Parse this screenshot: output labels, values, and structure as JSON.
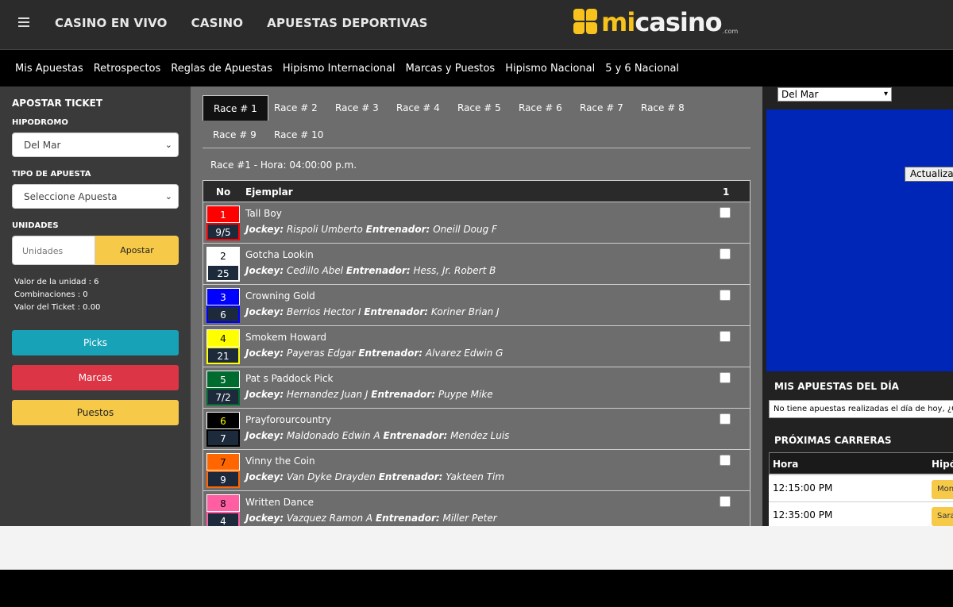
{
  "header": {
    "nav": [
      "CASINO EN VIVO",
      "CASINO",
      "APUESTAS DEPORTIVAS"
    ],
    "logo": {
      "mi": "mi",
      "casino": "casino",
      "com": ".com"
    },
    "colors": {
      "brand_yellow": "#f7c21b",
      "topbar": "#2b2b2b"
    }
  },
  "subnav": [
    "Mis Apuestas",
    "Retrospectos",
    "Reglas de Apuestas",
    "Hipismo Internacional",
    "Marcas y Puestos",
    "Hipismo Nacional",
    "5 y 6 Nacional"
  ],
  "ticket": {
    "title": "APOSTAR TICKET",
    "hipodromo_label": "HIPODROMO",
    "hipodromo_value": "Del Mar",
    "tipo_label": "TIPO DE APUESTA",
    "tipo_value": "Seleccione Apuesta",
    "unidades_label": "UNIDADES",
    "unidades_placeholder": "Unidades",
    "apostar": "Apostar",
    "valor_unidad": "Valor de la unidad : 6",
    "combinaciones": "Combinaciones : 0",
    "valor_ticket": "Valor del Ticket : 0.00",
    "picks": "Picks",
    "marcas": "Marcas",
    "puestos": "Puestos"
  },
  "races": {
    "tabs": [
      "Race # 1",
      "Race # 2",
      "Race # 3",
      "Race # 4",
      "Race # 5",
      "Race # 6",
      "Race # 7",
      "Race # 8",
      "Race # 9",
      "Race # 10"
    ],
    "active_tab": "Race # 1",
    "header": "Race #1 - Hora: 04:00:00 p.m.",
    "columns": {
      "no": "No",
      "ejemplar": "Ejemplar",
      "one": "1"
    },
    "jockey_label": "Jockey:",
    "trainer_label": "Entrenador:",
    "entries": [
      {
        "no": "1",
        "odds": "9/5",
        "horse": "Tall Boy",
        "jockey": "Rispoli Umberto",
        "trainer": "Oneill Doug F",
        "bg": "#ff0000",
        "fg": "#ffffff",
        "border": "#ff0000"
      },
      {
        "no": "2",
        "odds": "25",
        "horse": "Gotcha Lookin",
        "jockey": "Cedillo Abel",
        "trainer": "Hess, Jr. Robert B",
        "bg": "#ffffff",
        "fg": "#000000",
        "border": "#ffffff"
      },
      {
        "no": "3",
        "odds": "6",
        "horse": "Crowning Gold",
        "jockey": "Berrios Hector I",
        "trainer": "Koriner Brian J",
        "bg": "#0000ff",
        "fg": "#ffffff",
        "border": "#0000ff"
      },
      {
        "no": "4",
        "odds": "21",
        "horse": "Smokem Howard",
        "jockey": "Payeras Edgar",
        "trainer": "Alvarez Edwin G",
        "bg": "#ffff00",
        "fg": "#000000",
        "border": "#ffff00"
      },
      {
        "no": "5",
        "odds": "7/2",
        "horse": "Pat s Paddock Pick",
        "jockey": "Hernandez Juan J",
        "trainer": "Puype Mike",
        "bg": "#006b2e",
        "fg": "#ffffff",
        "border": "#006b2e"
      },
      {
        "no": "6",
        "odds": "7",
        "horse": "Prayforourcountry",
        "jockey": "Maldonado Edwin A",
        "trainer": "Mendez Luis",
        "bg": "#000000",
        "fg": "#ffff00",
        "border": "#000000"
      },
      {
        "no": "7",
        "odds": "9",
        "horse": "Vinny the Coin",
        "jockey": "Van Dyke Drayden",
        "trainer": "Yakteen Tim",
        "bg": "#ff6600",
        "fg": "#000000",
        "border": "#ff6600"
      },
      {
        "no": "8",
        "odds": "4",
        "horse": "Written Dance",
        "jockey": "Vazquez Ramon A",
        "trainer": "Miller Peter",
        "bg": "#ff5fa2",
        "fg": "#000000",
        "border": "#ff5fa2"
      }
    ]
  },
  "right": {
    "hipodromo": "Del Mar",
    "actualizar": "Actualizar",
    "mis_title": "MIS APUESTAS DEL DÍA",
    "mis_msg": "No tiene apuestas realizadas el día de hoy, ¿Qu",
    "prox_title": "PRÓXIMAS CARRERAS",
    "prox_cols": {
      "hora": "Hora",
      "hipodromo": "Hipó"
    },
    "prox_rows": [
      {
        "hora": "12:15:00 PM",
        "track": "Mon"
      },
      {
        "hora": "12:35:00 PM",
        "track": "Sara"
      }
    ],
    "video_color": "#0026b8"
  }
}
